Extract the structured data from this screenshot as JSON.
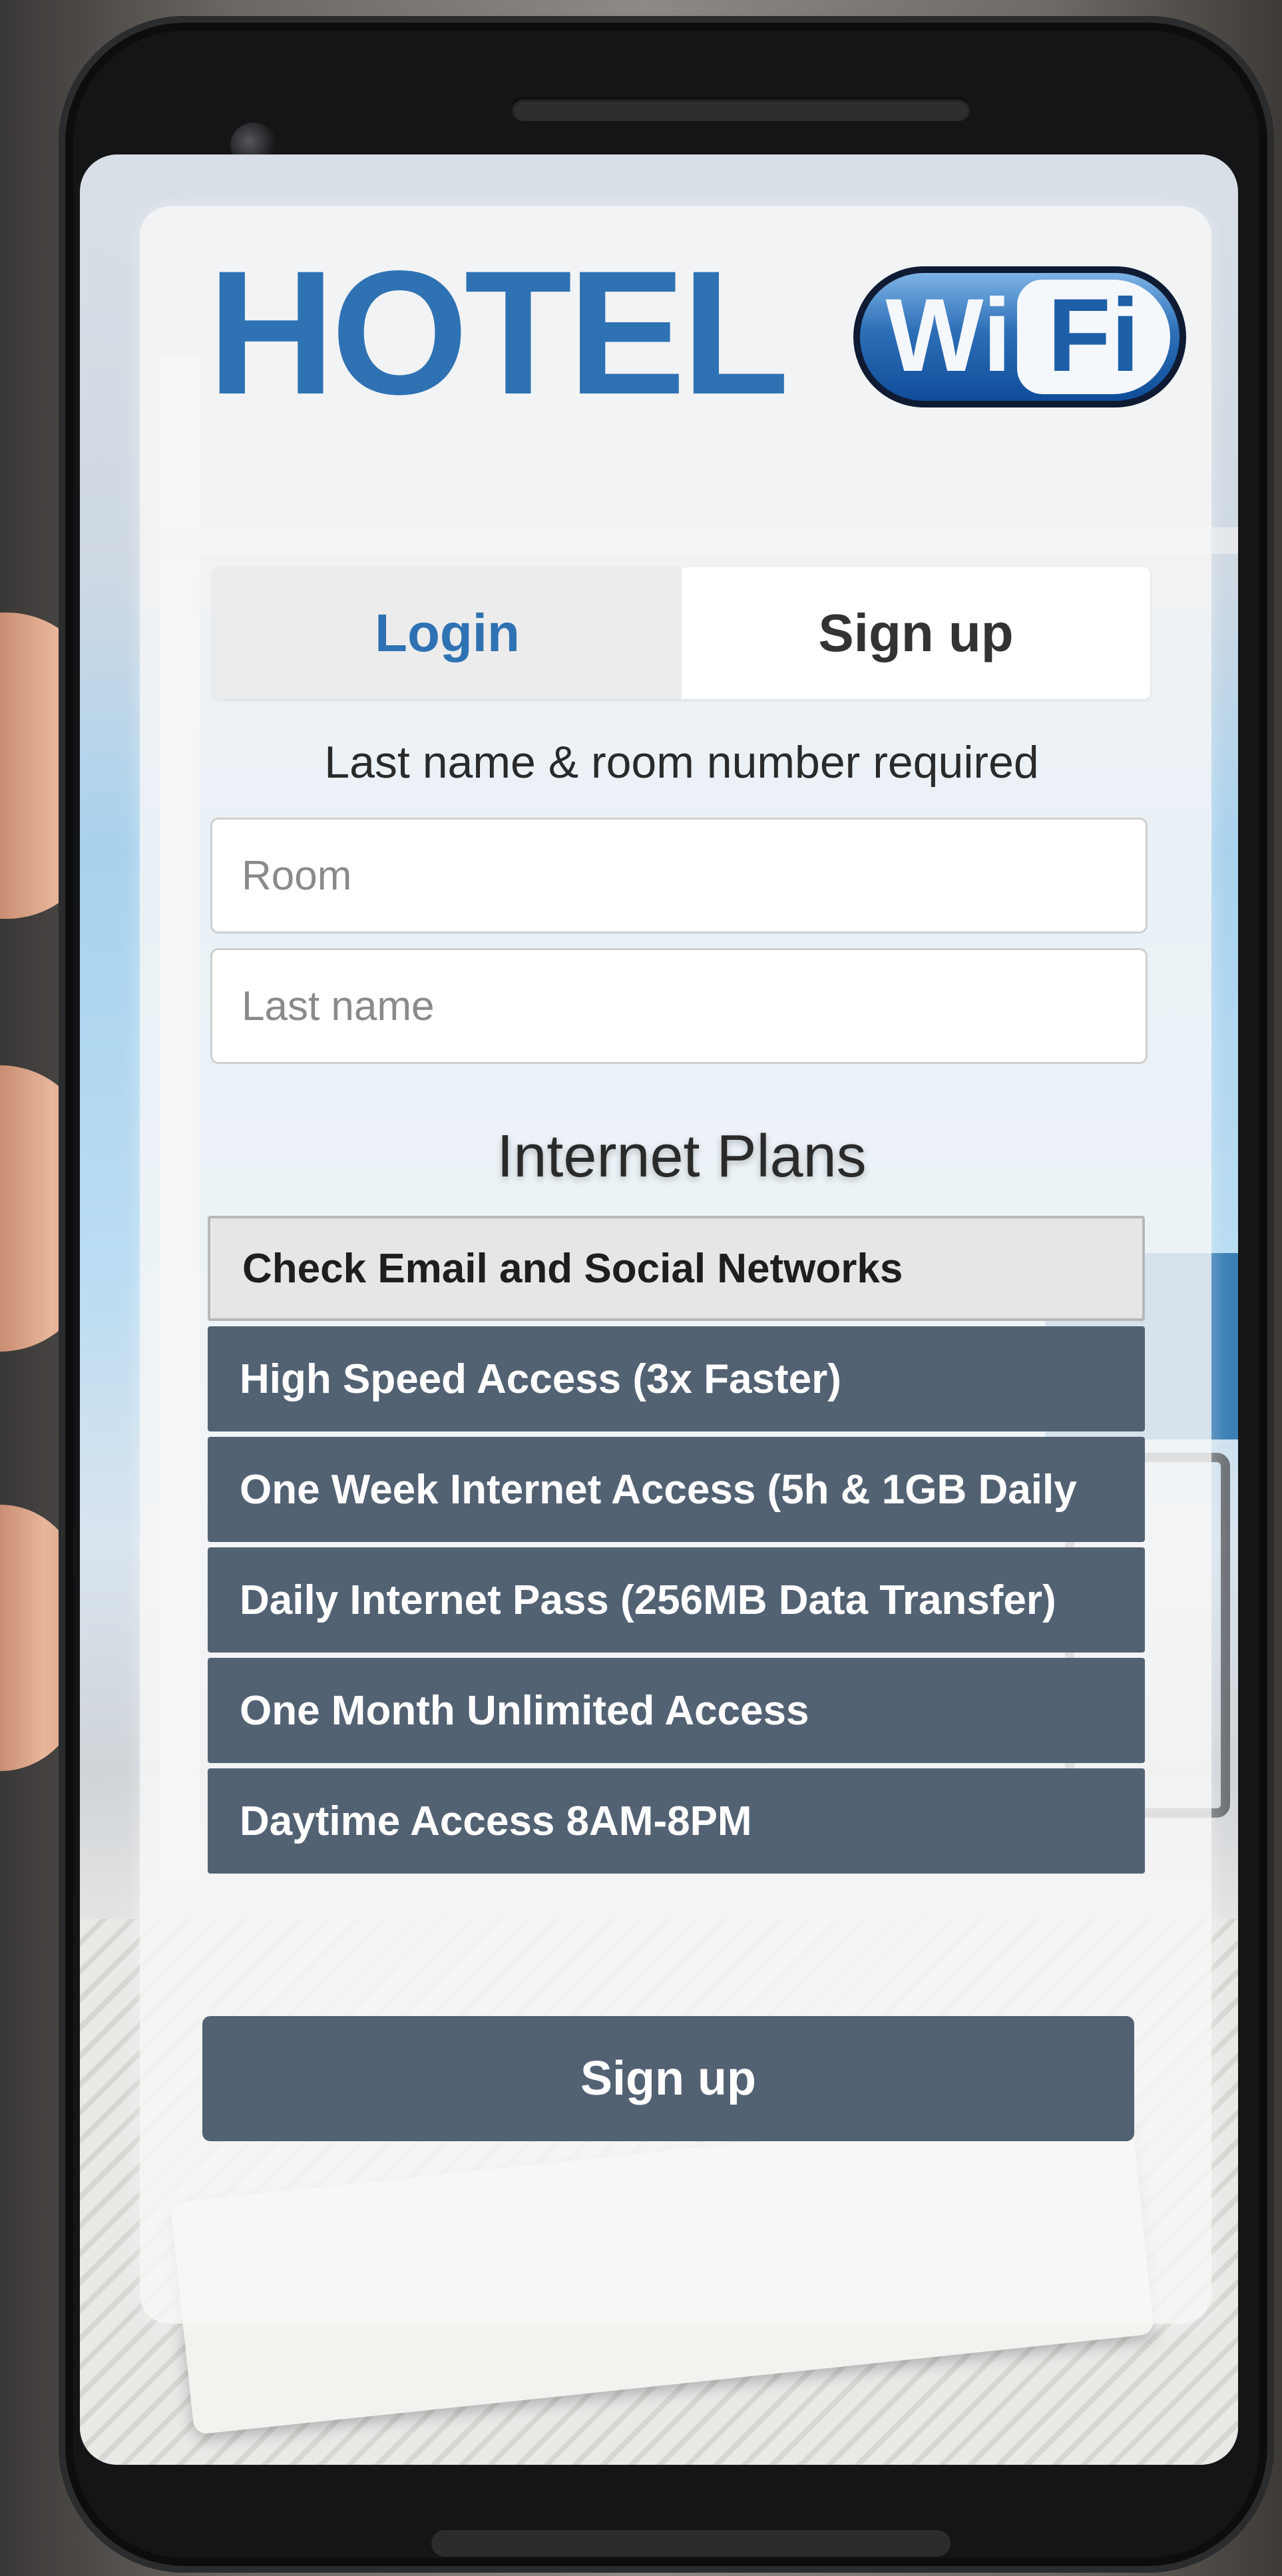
{
  "logo": {
    "hotel_text": "HOTEL",
    "wifi_wi": "Wi",
    "wifi_fi": "Fi"
  },
  "tabs": [
    {
      "label": "Login",
      "active": false
    },
    {
      "label": "Sign up",
      "active": true
    }
  ],
  "form": {
    "required_text": "Last name & room number required",
    "room": {
      "value": "",
      "placeholder": "Room"
    },
    "last_name": {
      "value": "",
      "placeholder": "Last name"
    }
  },
  "plans": {
    "title": "Internet Plans",
    "items": [
      {
        "label": "Check Email and Social Networks",
        "selected": true
      },
      {
        "label": "High Speed Access (3x Faster)",
        "selected": false
      },
      {
        "label": "One Week Internet Access (5h & 1GB Daily",
        "selected": false
      },
      {
        "label": "Daily Internet Pass (256MB Data Transfer)",
        "selected": false
      },
      {
        "label": "One Month Unlimited Access",
        "selected": false
      },
      {
        "label": "Daytime Access 8AM-8PM",
        "selected": false
      }
    ]
  },
  "submit": {
    "label": "Sign up"
  },
  "colors": {
    "brand_blue": "#2f72b3",
    "plan_bg": "#536273",
    "plan_selected_bg": "#e6e6e6"
  }
}
